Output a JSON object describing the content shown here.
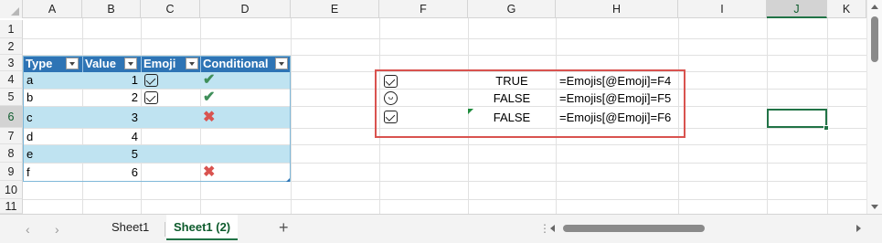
{
  "columns": [
    "A",
    "B",
    "C",
    "D",
    "E",
    "F",
    "G",
    "H",
    "I",
    "J",
    "K"
  ],
  "rows": [
    "1",
    "2",
    "3",
    "4",
    "5",
    "6",
    "7",
    "8",
    "9",
    "10",
    "11"
  ],
  "selected_column": "J",
  "selected_row": "6",
  "table": {
    "headers": [
      "Type",
      "Value",
      "Emoji",
      "Conditional"
    ],
    "rows": [
      {
        "type": "a",
        "value": "1",
        "emoji": "checkbox-icon",
        "conditional": "check-icon"
      },
      {
        "type": "b",
        "value": "2",
        "emoji": "checkbox-icon",
        "conditional": "check-icon"
      },
      {
        "type": "c",
        "value": "3",
        "emoji": "",
        "conditional": "cross-icon"
      },
      {
        "type": "d",
        "value": "4",
        "emoji": "",
        "conditional": ""
      },
      {
        "type": "e",
        "value": "5",
        "emoji": "",
        "conditional": ""
      },
      {
        "type": "f",
        "value": "6",
        "emoji": "",
        "conditional": "cross-icon"
      }
    ],
    "header_color": "#2e74b5",
    "band_color": "#bfe3f1"
  },
  "highlight_block": {
    "border_color": "#d9534f",
    "rows": [
      {
        "emoji": "checkbox-icon",
        "result": "TRUE",
        "formula": "=Emojis[@Emoji]=F4"
      },
      {
        "emoji": "smile-icon",
        "result": "FALSE",
        "formula": "=Emojis[@Emoji]=F5"
      },
      {
        "emoji": "checkbox-icon",
        "result": "FALSE",
        "formula": "=Emojis[@Emoji]=F6"
      }
    ]
  },
  "sheet_tabs": [
    {
      "label": "Sheet1",
      "active": false
    },
    {
      "label": "Sheet1 (2)",
      "active": true
    }
  ],
  "add_sheet_label": "+",
  "accent_color": "#217346"
}
